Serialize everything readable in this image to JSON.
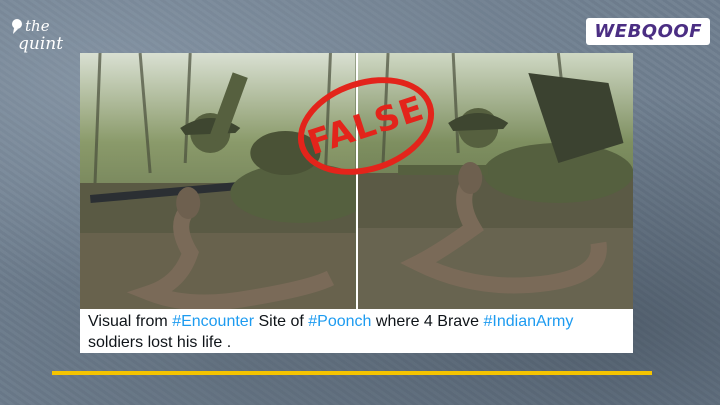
{
  "brand": {
    "quint_logo_text": "the quint",
    "webqoof_logo_text": "WEBQOOF"
  },
  "stamp": {
    "text": "FALSE"
  },
  "post": {
    "caption": {
      "part1": "Visual from ",
      "tag1": "#Encounter",
      "part2": " Site of ",
      "tag2": "#Poonch",
      "part3": " where 4 Brave ",
      "tag3": "#IndianArmy",
      "part4": " soldiers lost his life ."
    }
  },
  "colors": {
    "hashtag": "#1d9bf0",
    "stamp": "#e3241b",
    "accent_line": "#f5c400",
    "webqoof": "#4b2e83"
  }
}
